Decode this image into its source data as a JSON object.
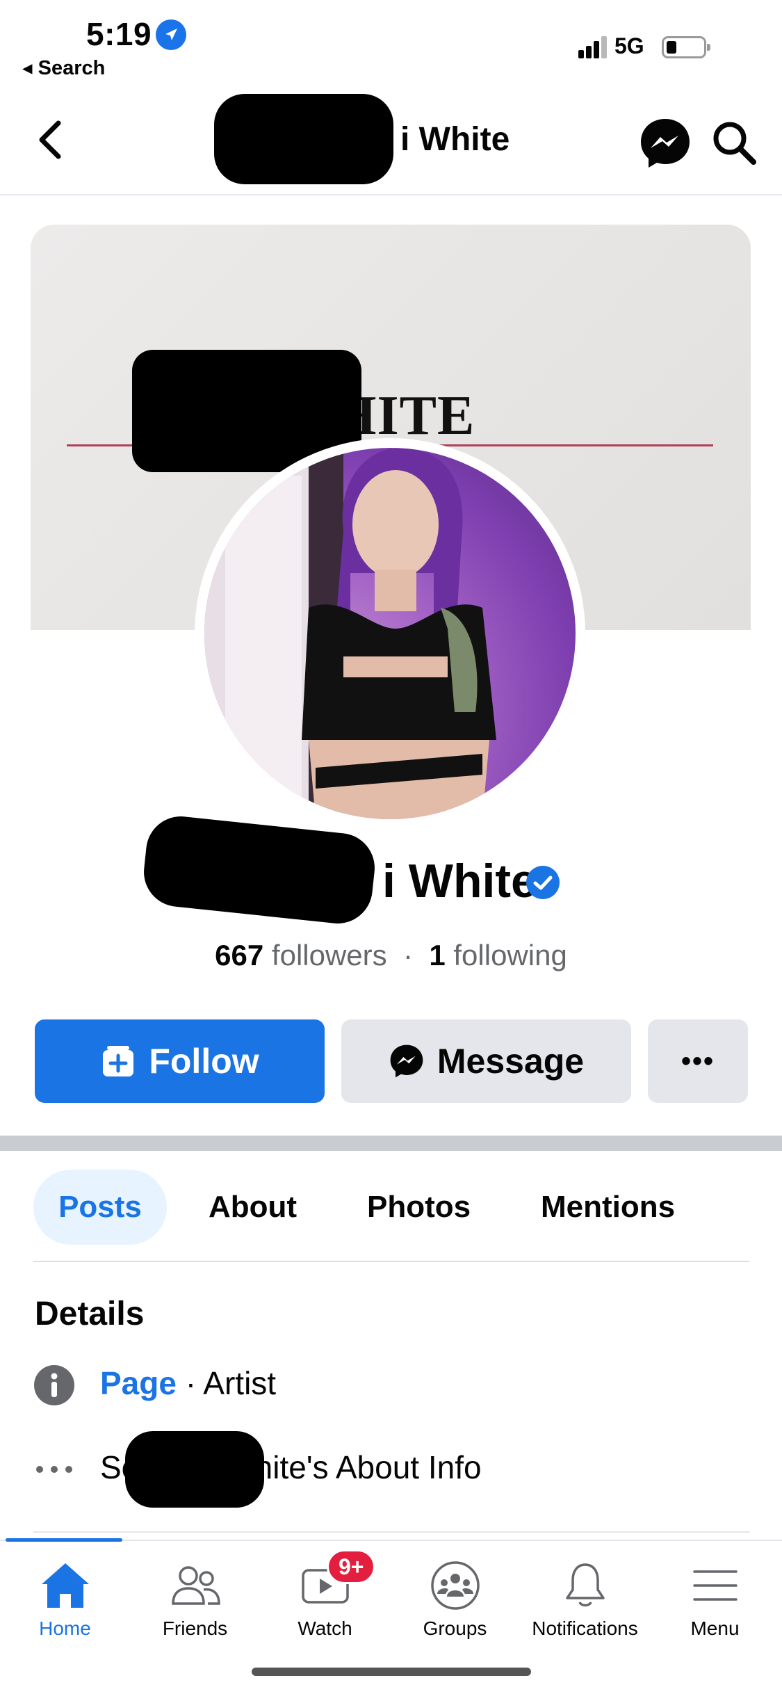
{
  "status_bar": {
    "time": "5:19",
    "back_label": "◂ Search",
    "network": "5G"
  },
  "header": {
    "title": "i White"
  },
  "cover": {
    "title_text": "ANI WHITE",
    "accent_line_color": "#b04058"
  },
  "profile": {
    "name": "i White",
    "followers_count": "667",
    "followers_label": "followers",
    "separator": "·",
    "following_count": "1",
    "following_label": "following"
  },
  "actions": {
    "follow_label": "Follow",
    "message_label": "Message",
    "more_label": "•••"
  },
  "tabs": [
    {
      "label": "Posts",
      "active": true
    },
    {
      "label": "About",
      "active": false
    },
    {
      "label": "Photos",
      "active": false
    },
    {
      "label": "Mentions",
      "active": false
    }
  ],
  "details": {
    "title": "Details",
    "category_link": "Page",
    "category_sep": " · ",
    "category_value": "Artist",
    "about_info_prefix": "Se",
    "about_info_suffix": "i White's About Info"
  },
  "bottom_nav": {
    "items": [
      {
        "label": "Home",
        "icon": "home-icon",
        "active": true
      },
      {
        "label": "Friends",
        "icon": "friends-icon",
        "active": false
      },
      {
        "label": "Watch",
        "icon": "watch-icon",
        "active": false
      },
      {
        "label": "Groups",
        "icon": "groups-icon",
        "active": false
      },
      {
        "label": "Notifications",
        "icon": "bell-icon",
        "active": false
      },
      {
        "label": "Menu",
        "icon": "menu-icon",
        "active": false
      }
    ],
    "watch_badge": "9+"
  },
  "colors": {
    "brand_blue": "#1b74e4",
    "badge_red": "#e41e3f",
    "button_gray": "#e4e6eb"
  }
}
